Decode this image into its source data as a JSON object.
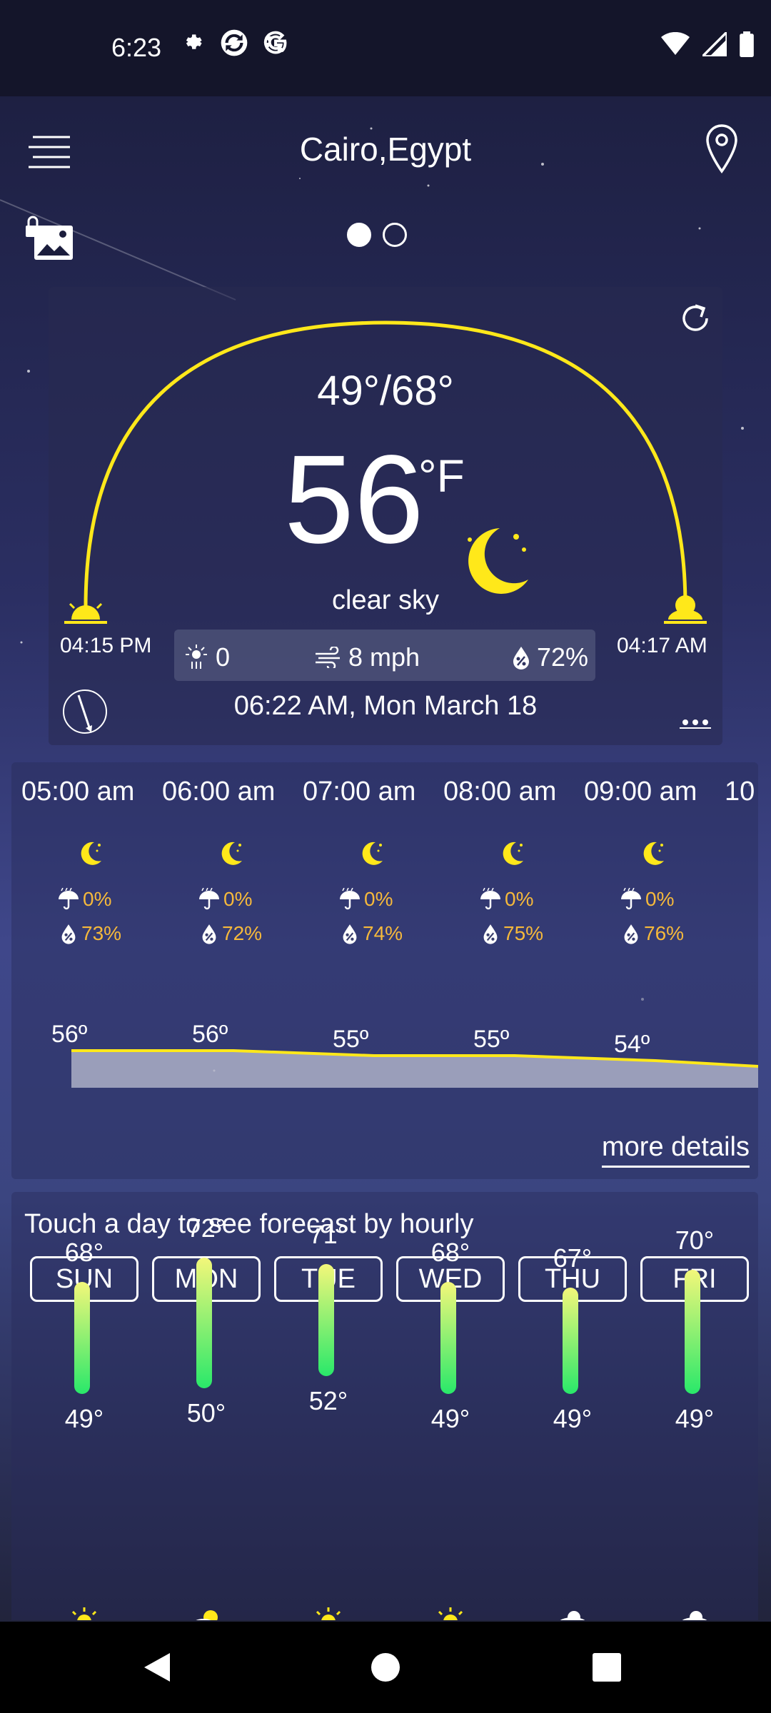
{
  "status_bar": {
    "time": "6:23"
  },
  "header": {
    "location": "Cairo,Egypt"
  },
  "current": {
    "minmax": "49°/68°",
    "temperature": "56",
    "unit": "°F",
    "condition": "clear sky",
    "sunset_time": "04:15 PM",
    "sunrise_time": "04:17 AM",
    "uv": "0",
    "wind": "8 mph",
    "humidity": "72%",
    "updated": "06:22 AM, Mon March 18"
  },
  "hourly": {
    "items": [
      {
        "time": "05:00 am",
        "precip": "0%",
        "humidity": "73%",
        "temp": "56º"
      },
      {
        "time": "06:00 am",
        "precip": "0%",
        "humidity": "72%",
        "temp": "56º"
      },
      {
        "time": "07:00 am",
        "precip": "0%",
        "humidity": "74%",
        "temp": "55º"
      },
      {
        "time": "08:00 am",
        "precip": "0%",
        "humidity": "75%",
        "temp": "55º"
      },
      {
        "time": "09:00 am",
        "precip": "0%",
        "humidity": "76%",
        "temp": "54º"
      },
      {
        "time": "10"
      }
    ],
    "more_details": "more details"
  },
  "daily": {
    "hint": "Touch a day to see forecast by hourly",
    "days": [
      {
        "name": "SUN",
        "high": "68°",
        "low": "49°",
        "high_value": 68,
        "low_value": 49,
        "icon": "sun-icon"
      },
      {
        "name": "MON",
        "high": "72°",
        "low": "50°",
        "high_value": 72,
        "low_value": 50,
        "icon": "partly-cloudy-icon"
      },
      {
        "name": "TUE",
        "high": "71°",
        "low": "52°",
        "high_value": 71,
        "low_value": 52,
        "icon": "sun-icon"
      },
      {
        "name": "WED",
        "high": "68°",
        "low": "49°",
        "high_value": 68,
        "low_value": 49,
        "icon": "sun-icon"
      },
      {
        "name": "THU",
        "high": "67°",
        "low": "49°",
        "high_value": 67,
        "low_value": 49,
        "icon": "cloud-icon"
      },
      {
        "name": "FRI",
        "high": "70°",
        "low": "49°",
        "high_value": 70,
        "low_value": 49,
        "icon": "cloud-icon"
      }
    ]
  },
  "colors": {
    "accent_yellow": "#ffe81a",
    "precip_orange": "#f6b93b",
    "bar_top": "#f3f77a",
    "bar_bottom": "#29e86a"
  }
}
